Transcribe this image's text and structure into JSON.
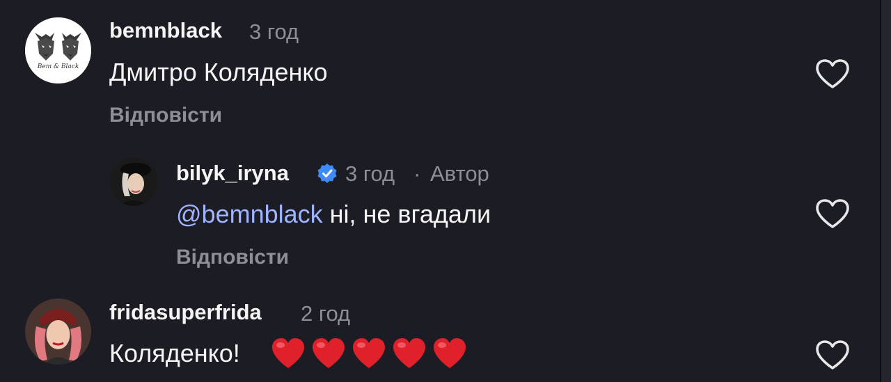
{
  "comments": [
    {
      "username": "bemnblack",
      "time": "3 год",
      "text": "Дмитро Коляденко",
      "reply_label": "Відповісти",
      "avatar_caption": "Bem & Black"
    },
    {
      "username": "bilyk_iryna",
      "time": "3 год",
      "separator": "·",
      "author_label": "Автор",
      "mention": "@bemnblack",
      "text": " ні, не вгадали",
      "reply_label": "Відповісти"
    },
    {
      "username": "fridasuperfrida",
      "time": "2 год",
      "text": "Коляденко!",
      "emoji_count": 5
    }
  ],
  "colors": {
    "background": "#1c1c24",
    "text": "#f5f5f5",
    "secondary": "#8e8e96",
    "mention": "#a1b4ff",
    "verified": "#3d8bf5",
    "heart_emoji": "#e0212b"
  },
  "icons": {
    "like": "heart-outline-icon",
    "verified": "verified-badge-icon",
    "emoji": "red-heart-emoji"
  }
}
